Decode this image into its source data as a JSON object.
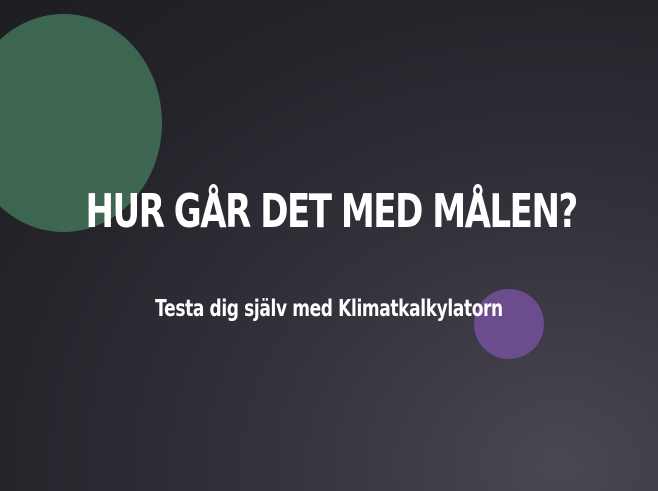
{
  "hero": {
    "headline": "HUR GÅR DET MED MÅLEN?",
    "subline": "Testa dig själv med Klimatkalkylatorn"
  },
  "colors": {
    "background": "#25242b",
    "green_circle": "#3f6a52",
    "purple_circle": "#6b4c8f",
    "text": "#ffffff"
  }
}
